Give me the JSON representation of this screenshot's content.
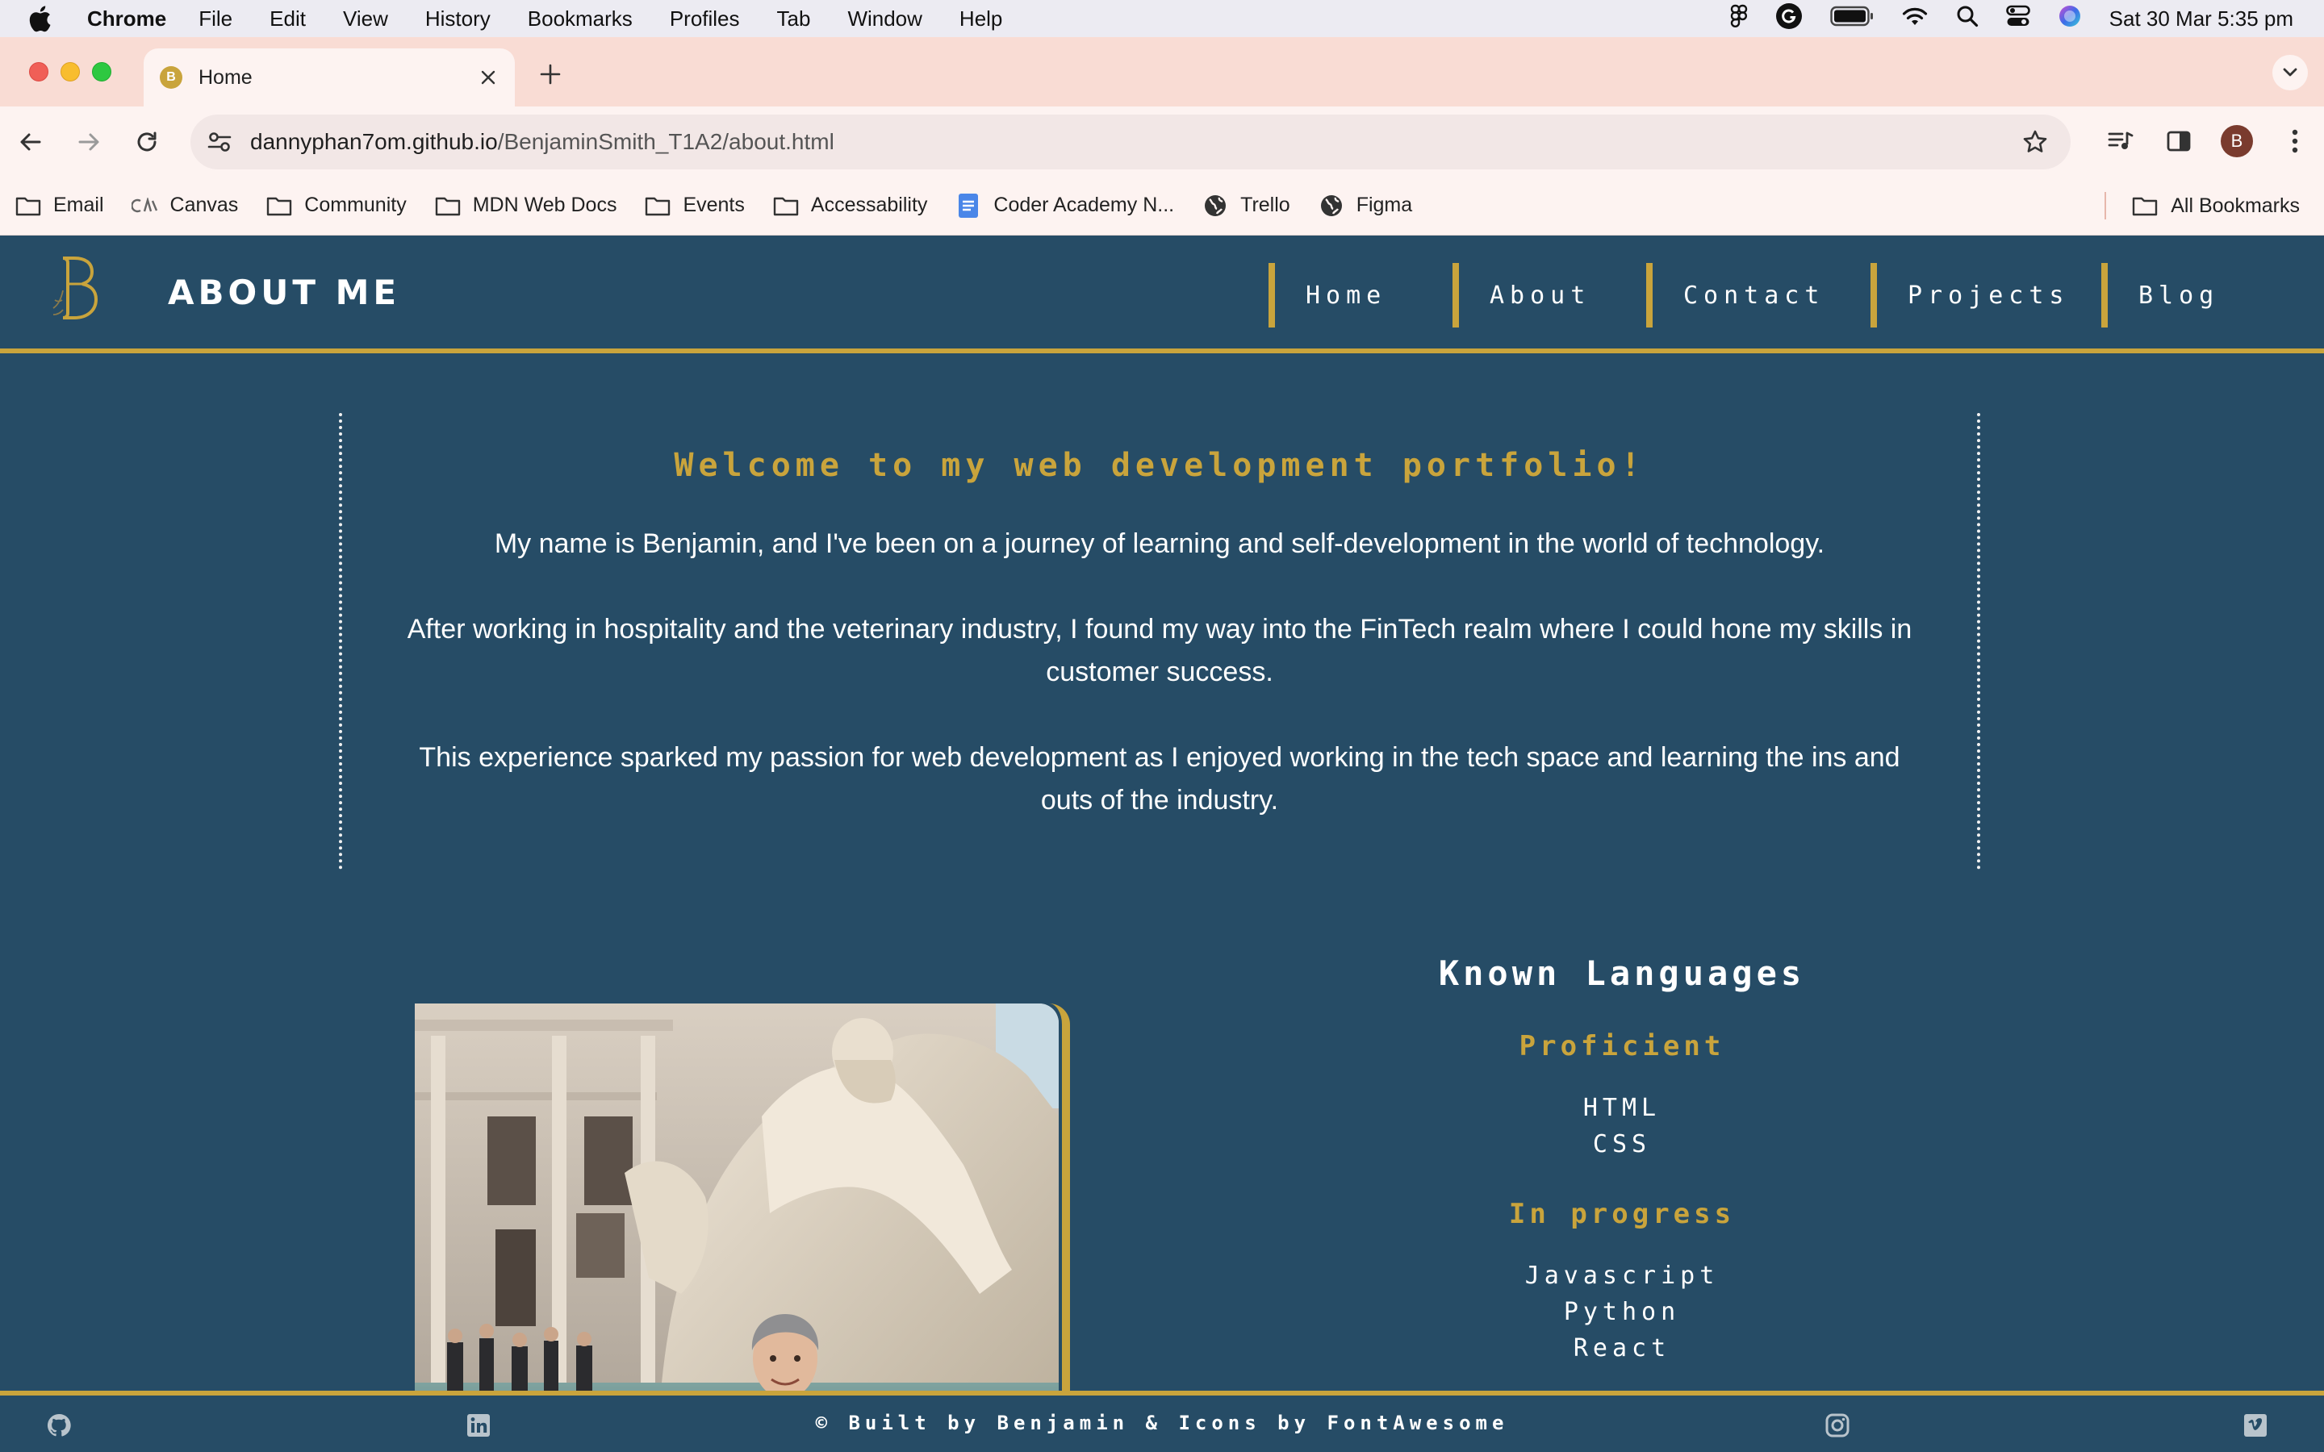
{
  "os_menubar": {
    "app": "Chrome",
    "items": [
      "File",
      "Edit",
      "View",
      "History",
      "Bookmarks",
      "Profiles",
      "Tab",
      "Window",
      "Help"
    ],
    "clock": "Sat 30 Mar  5:35 pm"
  },
  "browser": {
    "tab_title": "Home",
    "tab_favicon_letter": "B",
    "url_host": "dannyphan7om.github.io",
    "url_path": "/BenjaminSmith_T1A2/about.html",
    "profile_initial": "B",
    "bookmarks": [
      {
        "label": "Email",
        "icon": "folder-icon"
      },
      {
        "label": "Canvas",
        "icon": "canvas-icon"
      },
      {
        "label": "Community",
        "icon": "folder-icon"
      },
      {
        "label": "MDN Web Docs",
        "icon": "folder-icon"
      },
      {
        "label": "Events",
        "icon": "folder-icon"
      },
      {
        "label": "Accessability",
        "icon": "folder-icon"
      },
      {
        "label": "Coder Academy N...",
        "icon": "doc-icon"
      },
      {
        "label": "Trello",
        "icon": "globe-icon"
      },
      {
        "label": "Figma",
        "icon": "globe-icon"
      }
    ],
    "all_bookmarks": "All Bookmarks"
  },
  "site": {
    "title": "ABOUT ME",
    "nav": [
      "Home",
      "About",
      "Contact",
      "Projects",
      "Blog"
    ],
    "welcome_heading": "Welcome to my web development portfolio!",
    "paragraphs": [
      "My name is Benjamin, and I've been on a journey of learning and self-development in the world of technology.",
      "After working in hospitality and the veterinary industry, I found my way into the FinTech realm where I could hone my skills in customer success.",
      "This experience sparked my passion for web development as I enjoyed working in the tech space and learning the ins and outs of the industry."
    ],
    "languages": {
      "heading": "Known Languages",
      "proficient_label": "Proficient",
      "proficient": [
        "HTML",
        "CSS"
      ],
      "in_progress_label": "In progress",
      "in_progress": [
        "Javascript",
        "Python",
        "React"
      ]
    },
    "footer_text": "© Built by Benjamin & Icons by FontAwesome"
  },
  "colors": {
    "site_bg": "#264c66",
    "accent_gold": "#c9a43c",
    "tabstrip": "#f9dcd4"
  }
}
